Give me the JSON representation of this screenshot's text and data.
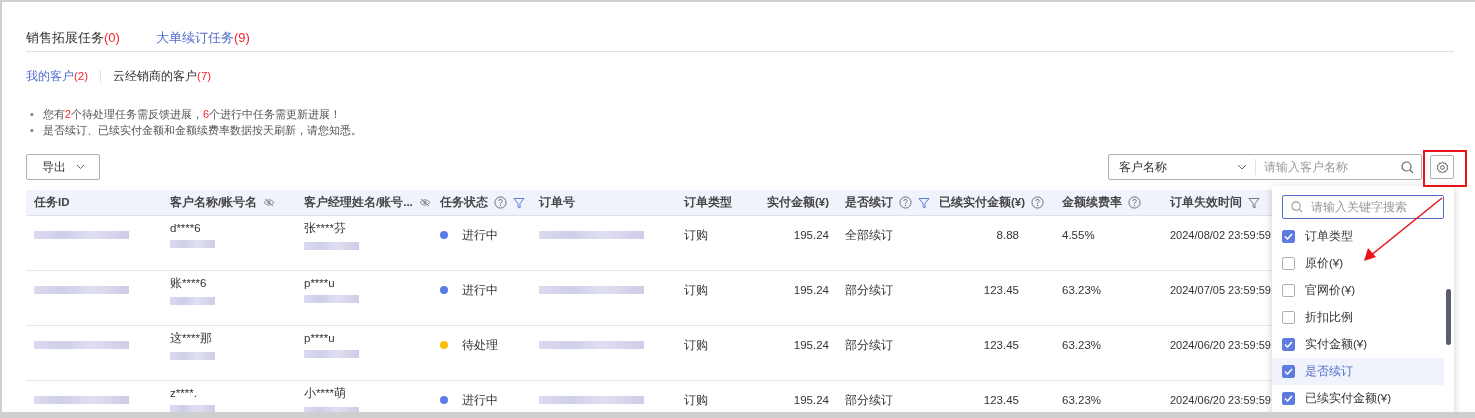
{
  "tabs": [
    {
      "label": "销售拓展任务",
      "count": "(0)",
      "selected": false
    },
    {
      "label": "大单续订任务",
      "count": "(9)",
      "selected": true
    }
  ],
  "sub_tabs": [
    {
      "label": "我的客户",
      "count": "(2)",
      "selected": true
    },
    {
      "label": "云经销商的客户",
      "count": "(7)",
      "selected": false
    }
  ],
  "notices": [
    {
      "bullet": "•",
      "segments": [
        {
          "text": "您有",
          "highlight": false
        },
        {
          "text": "2",
          "highlight": true
        },
        {
          "text": "个待处理任务需反馈进展，",
          "highlight": false
        },
        {
          "text": "6",
          "highlight": true
        },
        {
          "text": "个进行中任务需更新进展！",
          "highlight": false
        }
      ]
    },
    {
      "bullet": "•",
      "segments": [
        {
          "text": "是否续订、已续实付金额和金额续费率数据按天刷新，请您知悉。",
          "highlight": false
        }
      ]
    }
  ],
  "toolbar": {
    "export_button": "导出",
    "search_scope": "客户名称",
    "search_placeholder": "请输入客户名称"
  },
  "table": {
    "columns": [
      {
        "label": "任务ID",
        "help": false,
        "filter": false,
        "masked": false
      },
      {
        "label": "客户名称/账号名",
        "help": false,
        "filter": false,
        "masked": true
      },
      {
        "label": "客户经理姓名/账号...",
        "help": false,
        "filter": false,
        "masked": true
      },
      {
        "label": "任务状态",
        "help": true,
        "filter": true,
        "masked": false
      },
      {
        "label": "订单号",
        "help": false,
        "filter": false,
        "masked": false
      },
      {
        "label": "订单类型",
        "help": false,
        "filter": false,
        "masked": false
      },
      {
        "label": "实付金额(¥)",
        "help": false,
        "filter": false,
        "masked": false
      },
      {
        "label": "是否续订",
        "help": true,
        "filter": true,
        "masked": false
      },
      {
        "label": "已续实付金额(¥)",
        "help": true,
        "filter": false,
        "masked": false
      },
      {
        "label": "金额续费率",
        "help": true,
        "filter": false,
        "masked": false
      },
      {
        "label": "订单失效时间",
        "help": false,
        "filter": true,
        "masked": false
      }
    ],
    "rows": [
      {
        "customer": "d****6",
        "manager": "张****芬",
        "status": {
          "label": "进行中",
          "color": "#5b7be6"
        },
        "order_type": "订购",
        "paid": "195.24",
        "renewal": "全部续订",
        "renewed_paid": "8.88",
        "rate": "4.55%",
        "expiry": "2024/08/02 23:59:59"
      },
      {
        "customer": "账****6",
        "manager": "p****u",
        "status": {
          "label": "进行中",
          "color": "#5b7be6"
        },
        "order_type": "订购",
        "paid": "195.24",
        "renewal": "部分续订",
        "renewed_paid": "123.45",
        "rate": "63.23%",
        "expiry": "2024/07/05 23:59:59"
      },
      {
        "customer": "这****那",
        "manager": "p****u",
        "status": {
          "label": "待处理",
          "color": "#fbbd08"
        },
        "order_type": "订购",
        "paid": "195.24",
        "renewal": "部分续订",
        "renewed_paid": "123.45",
        "rate": "63.23%",
        "expiry": "2024/06/20 23:59:59"
      },
      {
        "customer": "z****.",
        "manager": "小****萌",
        "status": {
          "label": "进行中",
          "color": "#5b7be6"
        },
        "order_type": "订购",
        "paid": "195.24",
        "renewal": "部分续订",
        "renewed_paid": "123.45",
        "rate": "63.23%",
        "expiry": "2024/06/20 23:59:59"
      }
    ]
  },
  "column_menu": {
    "search_placeholder": "请输入关键字搜索",
    "items": [
      {
        "label": "订单类型",
        "checked": true,
        "selected": false
      },
      {
        "label": "原价(¥)",
        "checked": false,
        "selected": false
      },
      {
        "label": "官网价(¥)",
        "checked": false,
        "selected": false
      },
      {
        "label": "折扣比例",
        "checked": false,
        "selected": false
      },
      {
        "label": "实付金额(¥)",
        "checked": true,
        "selected": false
      },
      {
        "label": "是否续订",
        "checked": true,
        "selected": true
      },
      {
        "label": "已续实付金额(¥)",
        "checked": true,
        "selected": false
      }
    ]
  }
}
